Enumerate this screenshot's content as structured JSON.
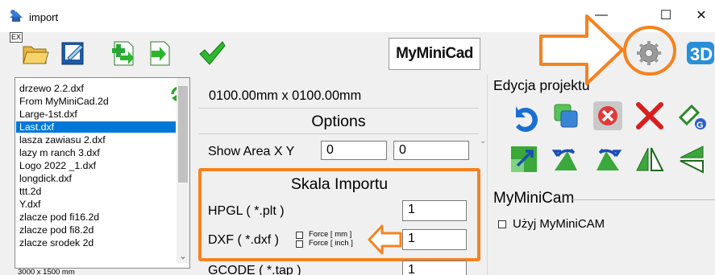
{
  "window": {
    "title": "import",
    "minimize_glyph": "—",
    "maximize_glyph": "☐",
    "close_glyph": "✕"
  },
  "toolbar": {
    "ex_label": "EX",
    "logo_text": "MyMiniCad",
    "icons": [
      "open-folder-icon",
      "edit-document-icon",
      "add-file-icon",
      "import-file-icon",
      "checkmark-icon",
      "settings-gear-icon",
      "3d-view-icon"
    ]
  },
  "file_list": {
    "items": [
      "drzewo 2.2.dxf",
      "From MyMiniCad.2d",
      "Large-1st.dxf",
      "Last.dxf",
      "lasza zawiasu 2.dxf",
      "lazy m ranch 3.dxf",
      "Logo 2022 _1.dxf",
      "longdick.dxf",
      "ttt.2d",
      "Y.dxf",
      "zlacze pod fi16.2d",
      "zlacze pod fi8.2d",
      "zlacze srodek 2d"
    ],
    "selected_index": 3,
    "dims_label": "3000 x 1500 mm",
    "scroll_down_glyph": "⌄"
  },
  "middle": {
    "size_label": "0100.00mm x  0100.00mm",
    "options_title": "Options",
    "show_area_label": "Show Area X Y",
    "show_area_x": "0",
    "show_area_y": "0",
    "skala_title": "Skala Importu",
    "hpgl_label": "HPGL ( *.plt )",
    "hpgl_value": "1",
    "dxf_label": "DXF ( *.dxf )",
    "dxf_value": "1",
    "force_mm": "Force [ mm ]",
    "force_inch": "Force [ inch ]",
    "gcode_label": "GCODE ( *.tap )",
    "gcode_value": "1"
  },
  "right": {
    "edycja_title": "Edycja projektu",
    "buttons": [
      "undo-icon",
      "copy-icon",
      "delete-circle-icon",
      "cut-x-icon",
      "rotate-group-icon",
      "scale-icon",
      "rotate-left-icon",
      "rotate-right-icon",
      "mirror-vertical-icon",
      "mirror-horizontal-icon"
    ],
    "mmcam_title": "MyMiniCam",
    "use_mmcam_label": "Użyj MyMiniCAM"
  },
  "colors": {
    "accent_orange": "#f58220",
    "selection_blue": "#0078d7"
  }
}
